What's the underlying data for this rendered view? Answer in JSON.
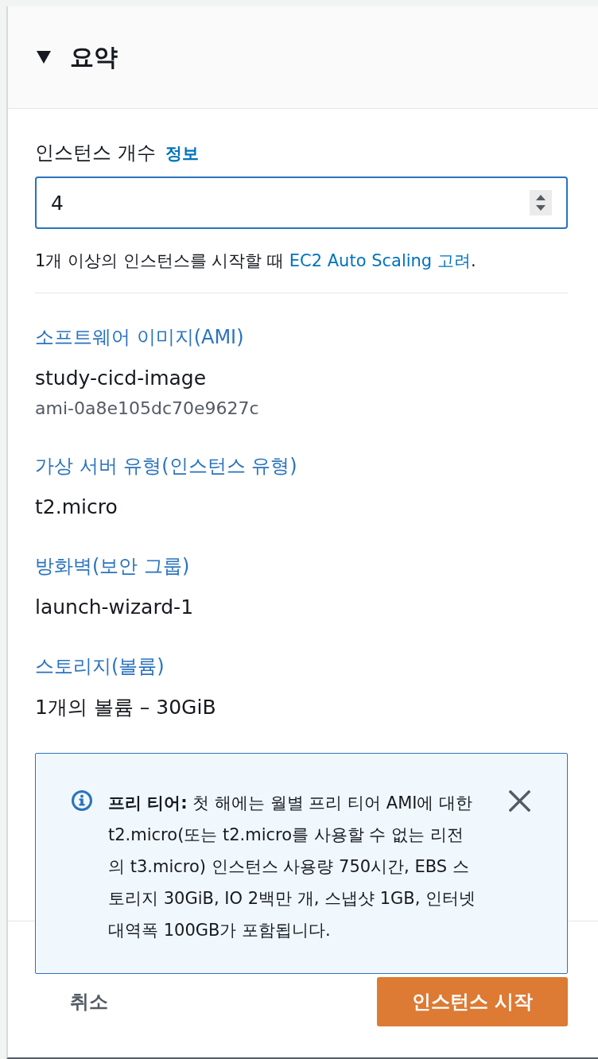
{
  "summary": {
    "title": "요약",
    "expanded": true
  },
  "instance_count": {
    "label": "인스턴스 개수",
    "info_link": "정보",
    "value": "4",
    "help_text": "1개 이상의 인스턴스를 시작할 때 ",
    "help_link": "EC2 Auto Scaling 고려",
    "help_end": "."
  },
  "sections": [
    {
      "heading": "소프트웨어 이미지(AMI)",
      "value": "study-cicd-image",
      "detail": "ami-0a8e105dc70e9627c"
    },
    {
      "heading": "가상 서버 유형(인스턴스 유형)",
      "value": "t2.micro"
    },
    {
      "heading": "방화벽(보안 그룹)",
      "value": "launch-wizard-1"
    },
    {
      "heading": "스토리지(볼륨)",
      "value": "1개의 볼륨 – 30GiB"
    }
  ],
  "alert": {
    "kind": "info",
    "text": "**프리 티어:** 첫 해에는 월별 프리 티어 AMI에 대한 t2.micro(또는 t2.micro를 사용할 수 없는 리전의 t3.micro) 인스턴스 사용량 750시간, EBS 스토리지 30GiB, IO 2백만 개, 스냅샷 1GB, 인터넷 대역폭 100GB가 포함됩니다."
  },
  "footer": {
    "cancel": "취소",
    "submit": "인스턴스 시작"
  }
}
